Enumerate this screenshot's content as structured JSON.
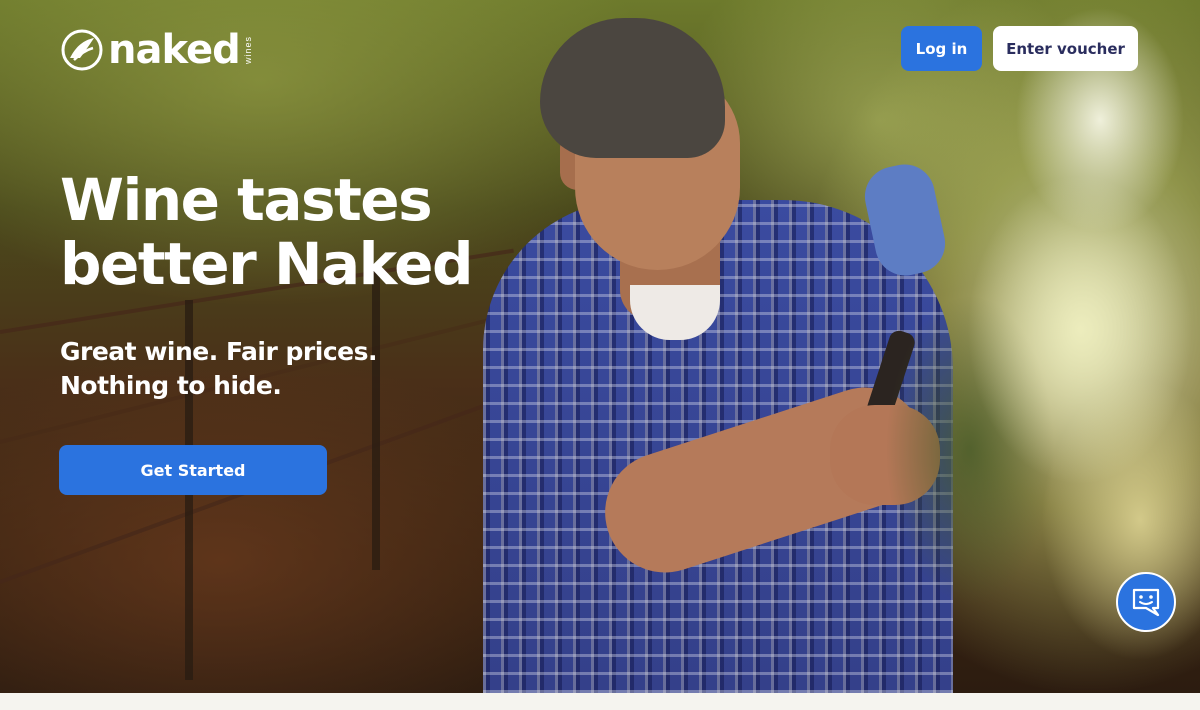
{
  "header": {
    "logo": {
      "wordmark": "naked",
      "sub": "wines",
      "icon": "naked-wines-logo-icon"
    },
    "login_label": "Log in",
    "voucher_label": "Enter voucher"
  },
  "hero": {
    "title_line1": "Wine tastes",
    "title_line2": "better Naked",
    "subtitle_line1": "Great wine. Fair prices.",
    "subtitle_line2": "Nothing to hide.",
    "cta_label": "Get Started",
    "image_description": "vineyard-farmer-photo"
  },
  "chat": {
    "icon": "chat-smiley-icon"
  },
  "colors": {
    "primary": "#2b73df",
    "voucher_text": "#2a2d5e",
    "footer_bg": "#f5f4ef",
    "white": "#ffffff"
  }
}
